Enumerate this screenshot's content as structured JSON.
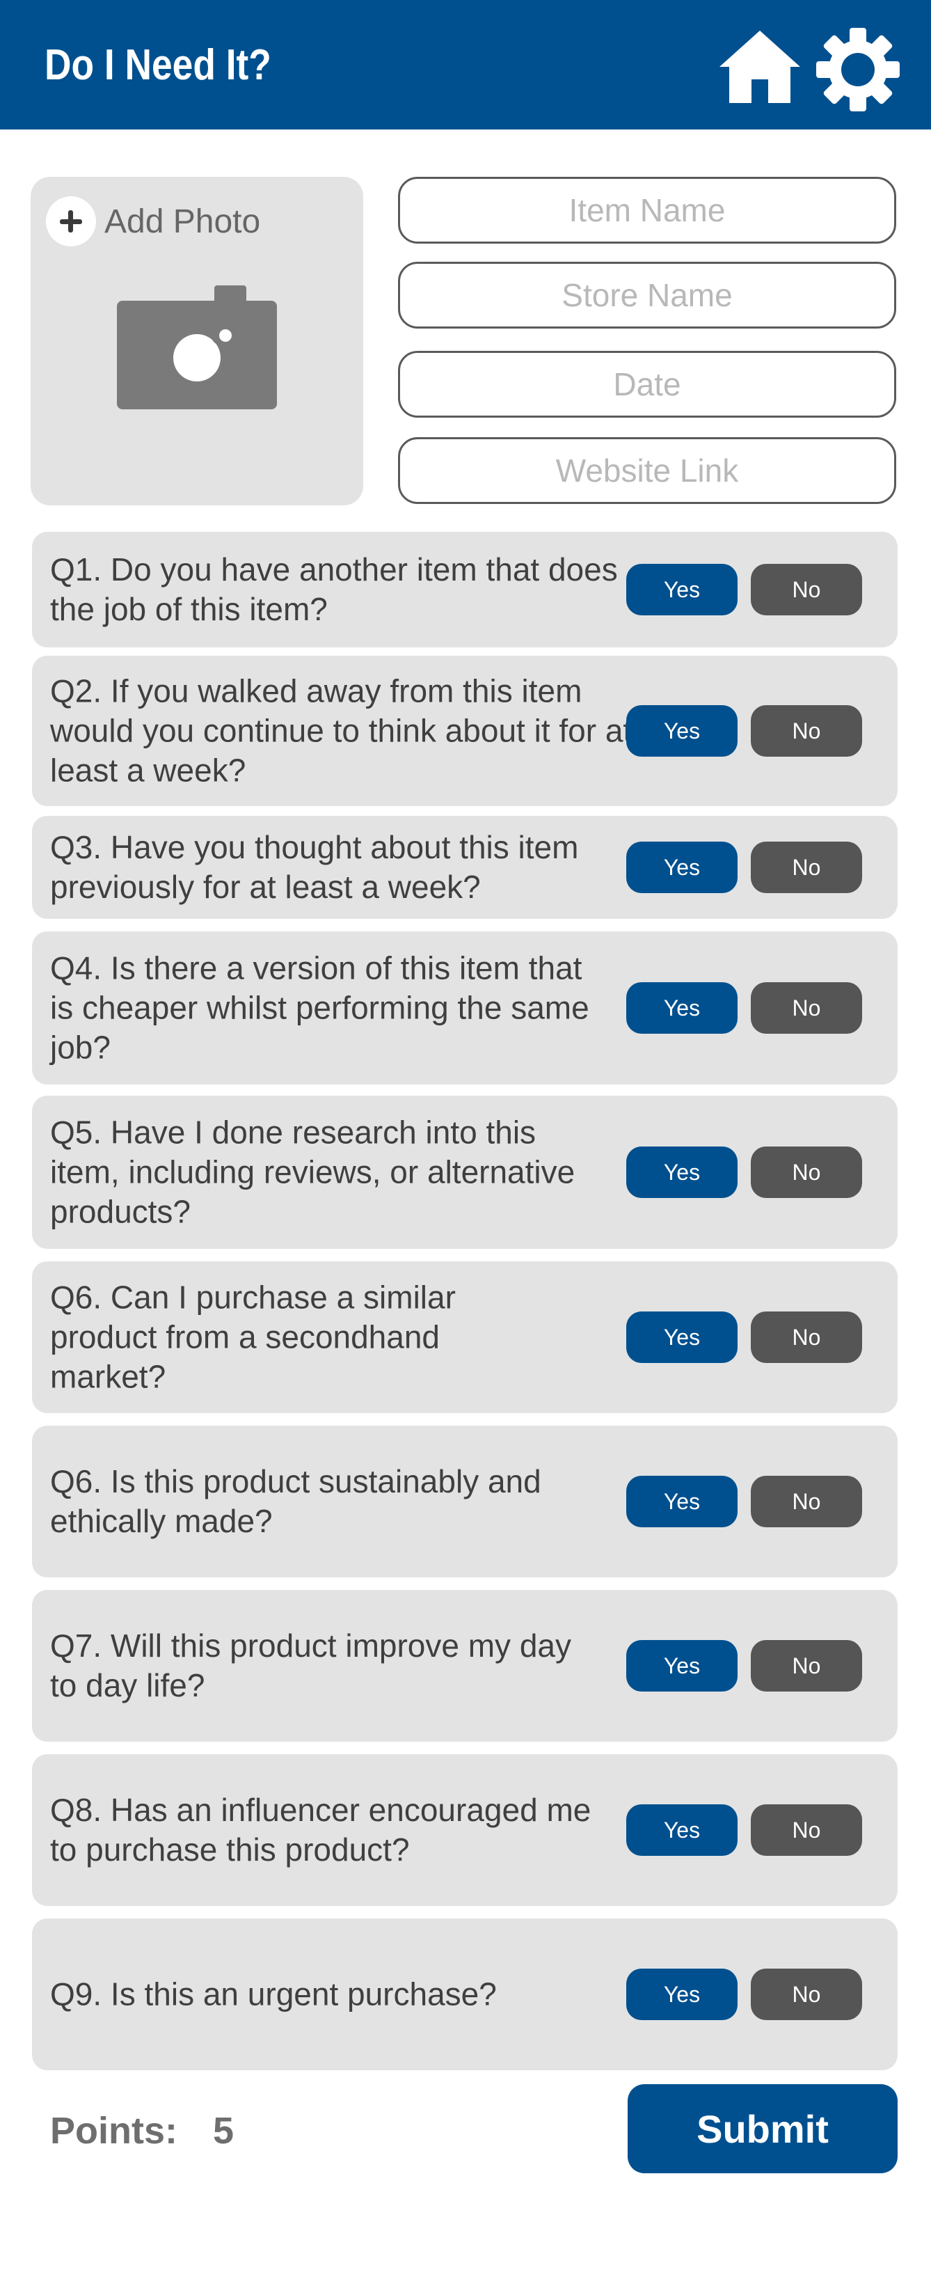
{
  "header": {
    "title": "Do I Need It?",
    "home_icon": "home-icon",
    "settings_icon": "gear-icon",
    "color": "#00508f"
  },
  "photo": {
    "add_label": "Add Photo",
    "icon": "camera-icon"
  },
  "fields": {
    "item_name": {
      "placeholder": "Item Name",
      "value": ""
    },
    "store_name": {
      "placeholder": "Store Name",
      "value": ""
    },
    "date": {
      "placeholder": "Date",
      "value": ""
    },
    "website_link": {
      "placeholder": "Website Link",
      "value": ""
    }
  },
  "buttons": {
    "yes_label": "Yes",
    "no_label": "No"
  },
  "questions": [
    {
      "text": "Q1. Do you have another item that does the job of this item?"
    },
    {
      "text": "Q2. If you walked away from this item would you continue to think about it for at least a week?"
    },
    {
      "text": "Q3. Have you thought about this item previously for at least a week?"
    },
    {
      "text": "Q4. Is there a version of this item that is cheaper whilst performing the same job?"
    },
    {
      "text": "Q5. Have I done research into this item, including reviews, or alternative products?"
    },
    {
      "text": "Q6. Can I purchase a similar product from a secondhand market?"
    },
    {
      "text": "Q6. Is this product sustainably and ethically made?"
    },
    {
      "text": "Q7. Will this product improve my day to day life?"
    },
    {
      "text": "Q8. Has an influencer encouraged me to purchase this product?"
    },
    {
      "text": "Q9. Is this an urgent purchase?"
    }
  ],
  "footer": {
    "points_label": "Points:",
    "points_value": "5",
    "submit_label": "Submit"
  },
  "colors": {
    "primary": "#00508f",
    "no_button": "#555555",
    "card": "#e3e3e3"
  }
}
